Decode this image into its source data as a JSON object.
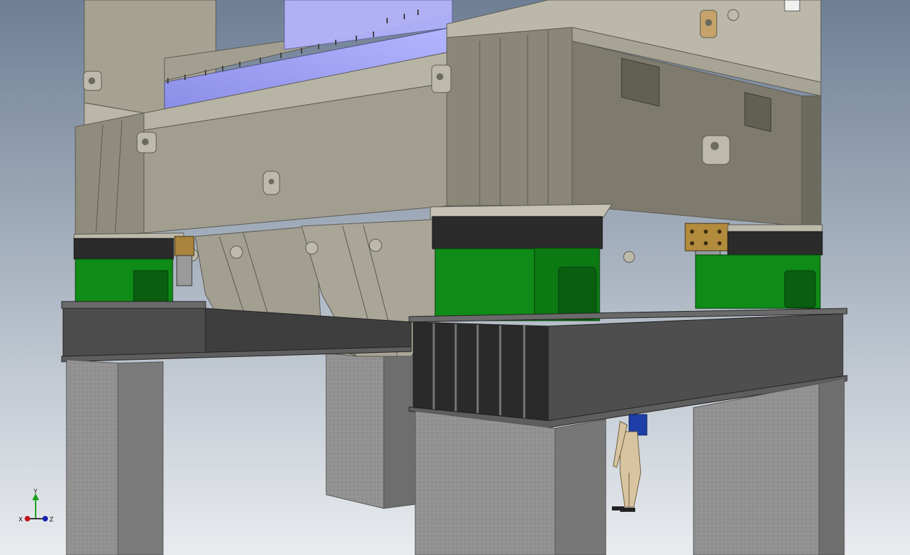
{
  "viewport": {
    "background_top": "#6e7f95",
    "background_bottom": "#e9ecef"
  },
  "triad": {
    "x_label": "X",
    "y_label": "Y",
    "z_label": "Z",
    "x_color": "#c0161b",
    "y_color": "#1aa01a",
    "z_color": "#1622b0"
  },
  "colors": {
    "frame": "#a09c8e",
    "frame_dark": "#8a8779",
    "frame_light": "#bdb9ab",
    "green": "#0f8c17",
    "green_dark": "#0a5e0f",
    "black_pad": "#2b2b2b",
    "steel_beam": "#4c4c4c",
    "steel_beam_dark": "#353535",
    "concrete": "#8f8f8f",
    "concrete_dark": "#6f6f6f",
    "blue_panel": "#9a9cf0",
    "bronze": "#a8843c",
    "person_shirt": "#1e3ea8",
    "person_skin": "#d8c4a0"
  }
}
